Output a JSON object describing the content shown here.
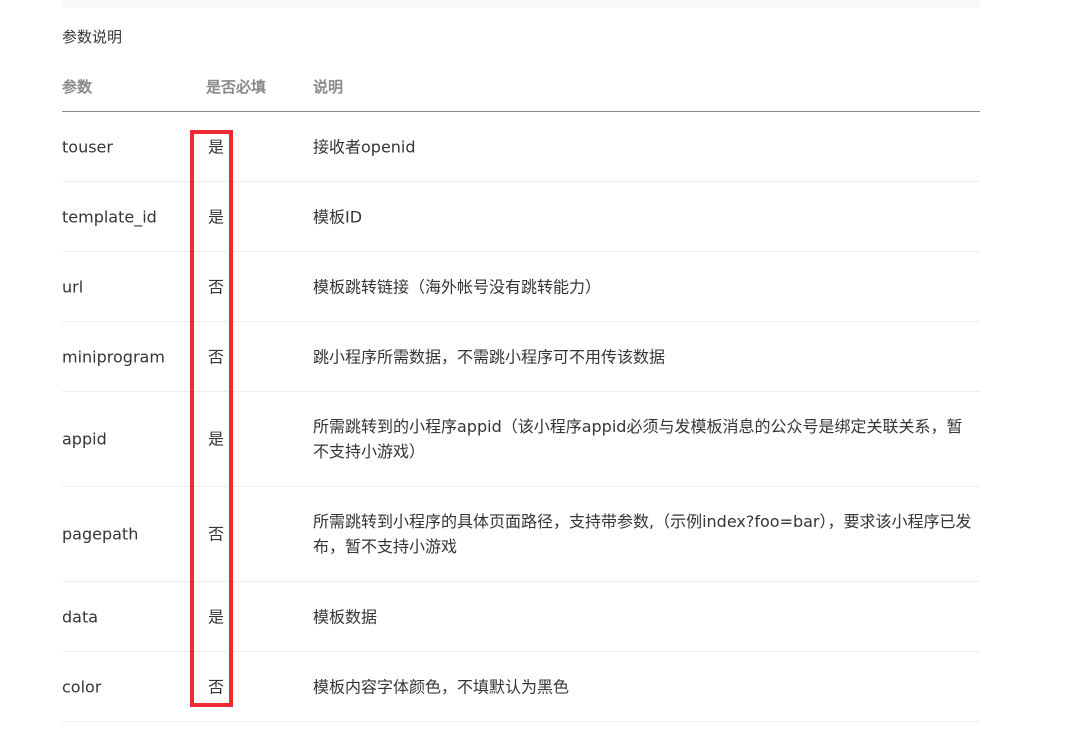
{
  "section_title": "参数说明",
  "table": {
    "headers": {
      "param": "参数",
      "required": "是否必填",
      "description": "说明"
    },
    "rows": [
      {
        "param": "touser",
        "required": "是",
        "description": "接收者openid"
      },
      {
        "param": "template_id",
        "required": "是",
        "description": "模板ID"
      },
      {
        "param": "url",
        "required": "否",
        "description": "模板跳转链接（海外帐号没有跳转能力）"
      },
      {
        "param": "miniprogram",
        "required": "否",
        "description": "跳小程序所需数据，不需跳小程序可不用传该数据"
      },
      {
        "param": "appid",
        "required": "是",
        "description": "所需跳转到的小程序appid（该小程序appid必须与发模板消息的公众号是绑定关联关系，暂不支持小游戏）"
      },
      {
        "param": "pagepath",
        "required": "否",
        "description": "所需跳转到小程序的具体页面路径，支持带参数,（示例index?foo=bar），要求该小程序已发布，暂不支持小游戏"
      },
      {
        "param": "data",
        "required": "是",
        "description": "模板数据"
      },
      {
        "param": "color",
        "required": "否",
        "description": "模板内容字体颜色，不填默认为黑色"
      }
    ]
  },
  "colors": {
    "highlight": "#ee2b35",
    "header_text": "#8a8a8a",
    "body_text": "#353535"
  }
}
